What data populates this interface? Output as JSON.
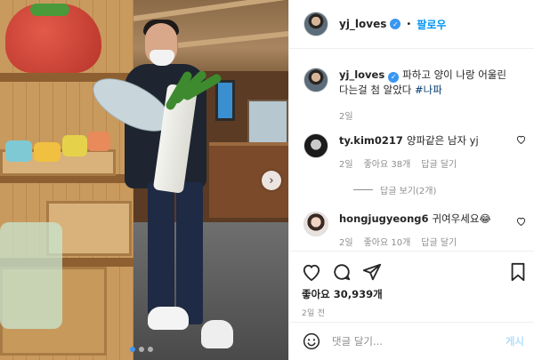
{
  "post": {
    "username": "yj_loves",
    "follow_label": "팔로우",
    "separator": "•",
    "caption": "파하고 양이 나랑 어울린다는걸 첨 알았다",
    "hashtag": "#나파",
    "caption_time": "2일",
    "likes_label": "좋아요 30,939개",
    "post_time": "2일 전"
  },
  "comments": [
    {
      "username": "ty.kim0217",
      "text": "양파같은 남자 yj",
      "time": "2일",
      "likes": "좋아요 38개",
      "reply_label": "답글 달기",
      "view_replies": "답글 보기(2개)"
    },
    {
      "username": "hongjugyeong6",
      "text": "귀여우세요😂",
      "time": "2일",
      "likes": "좋아요 10개",
      "reply_label": "답글 달기"
    }
  ],
  "composer": {
    "placeholder": "댓글 달기...",
    "post_label": "게시"
  },
  "icons": {
    "verified": "verified-badge-icon",
    "heart": "heart-icon",
    "comment": "comment-icon",
    "share": "share-icon",
    "save": "bookmark-icon",
    "emoji": "emoji-icon",
    "next": "chevron-right-icon"
  },
  "carousel": {
    "total_slides": 3,
    "current_slide": 1
  },
  "colors": {
    "accent": "#0095f6",
    "verified": "#3897f0",
    "muted": "#8e8e8e",
    "post_disabled": "#b2dffc"
  }
}
